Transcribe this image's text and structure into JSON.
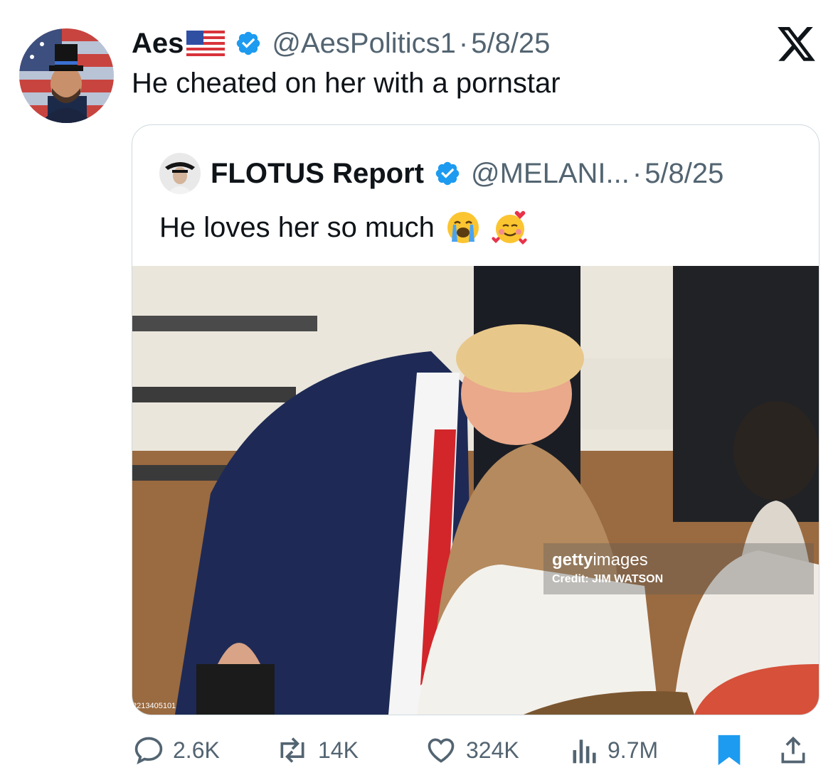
{
  "tweet": {
    "author_name": "Aes",
    "handle": "@AesPolitics1",
    "separator": "·",
    "date": "5/8/25",
    "text": "He cheated on her with a pornstar"
  },
  "quoted_tweet": {
    "author_name": "FLOTUS Report",
    "handle": "@MELANI...",
    "separator": "·",
    "date": "5/8/25",
    "text": "He loves her so much",
    "image": {
      "watermark_brand_bold": "getty",
      "watermark_brand_light": "images",
      "watermark_credit": "Credit: JIM WATSON",
      "image_id": "2213405101"
    }
  },
  "actions": {
    "replies": "2.6K",
    "reposts": "14K",
    "likes": "324K",
    "views": "9.7M"
  },
  "colors": {
    "verified_badge": "#1d9bf0",
    "bookmark_active": "#1d9bf0",
    "secondary_text": "#536471",
    "border": "#cfd9de"
  },
  "icons": [
    "verified-badge-icon",
    "x-logo-icon",
    "reply-icon",
    "repost-icon",
    "like-icon",
    "views-icon",
    "bookmark-icon",
    "share-icon",
    "loudly-crying-face-emoji",
    "smiling-face-with-hearts-emoji",
    "us-flag-emoji"
  ]
}
